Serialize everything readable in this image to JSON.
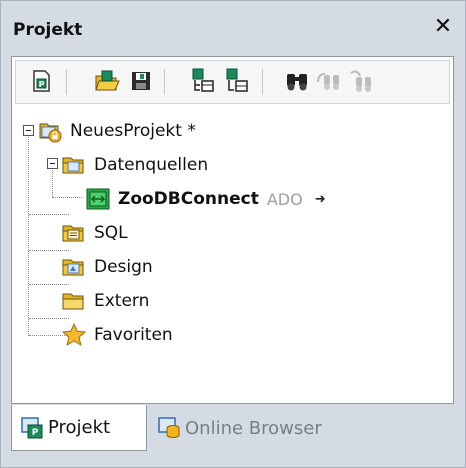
{
  "panel": {
    "title": "Projekt",
    "close_glyph": "✕"
  },
  "toolbar": {
    "buttons": [
      {
        "name": "new-project-icon"
      },
      {
        "name": "open-project-icon"
      },
      {
        "name": "save-project-icon"
      },
      {
        "name": "add-to-project-icon"
      },
      {
        "name": "add-active-file-icon"
      },
      {
        "name": "find-icon"
      },
      {
        "name": "find-next-icon"
      },
      {
        "name": "replace-icon"
      }
    ]
  },
  "tree": {
    "root": {
      "label": "NeuesProjekt *",
      "icon": "project-icon"
    },
    "datasources": {
      "label": "Datenquellen",
      "icon": "folder-icon"
    },
    "connection": {
      "label": "ZooDBConnect",
      "type": "ADO",
      "icon": "db-connection-icon",
      "arrow": "➜"
    },
    "sql": {
      "label": "SQL",
      "icon": "folder-icon"
    },
    "design": {
      "label": "Design",
      "icon": "folder-icon"
    },
    "extern": {
      "label": "Extern",
      "icon": "folder-icon"
    },
    "favorites": {
      "label": "Favoriten",
      "icon": "star-icon"
    }
  },
  "tabs": [
    {
      "label": "Projekt",
      "active": true
    },
    {
      "label": "Online Browser",
      "active": false
    }
  ]
}
